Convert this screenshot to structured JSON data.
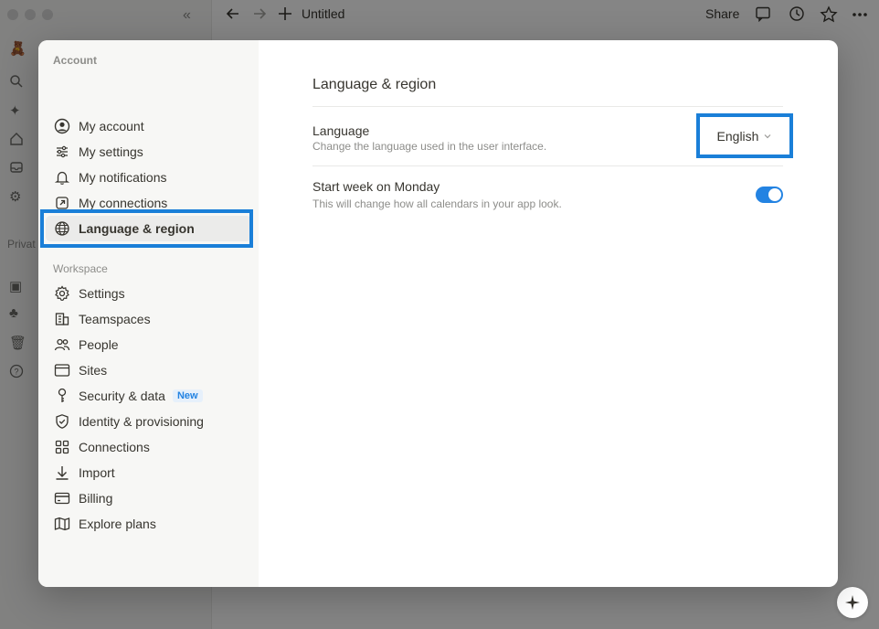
{
  "topbar": {
    "page_title": "Untitled",
    "share_label": "Share"
  },
  "background_sidebar": {
    "section_label": "Privat"
  },
  "modal": {
    "account_label": "Account",
    "account_items": [
      {
        "label": "My account",
        "icon": "user-circle-icon"
      },
      {
        "label": "My settings",
        "icon": "sliders-icon"
      },
      {
        "label": "My notifications",
        "icon": "bell-icon"
      },
      {
        "label": "My connections",
        "icon": "external-link-icon"
      },
      {
        "label": "Language & region",
        "icon": "globe-icon",
        "active": true
      }
    ],
    "workspace_label": "Workspace",
    "workspace_items": [
      {
        "label": "Settings",
        "icon": "gear-icon"
      },
      {
        "label": "Teamspaces",
        "icon": "building-icon"
      },
      {
        "label": "People",
        "icon": "people-icon"
      },
      {
        "label": "Sites",
        "icon": "browser-icon"
      },
      {
        "label": "Security & data",
        "icon": "key-icon",
        "badge": "New"
      },
      {
        "label": "Identity & provisioning",
        "icon": "shield-check-icon"
      },
      {
        "label": "Connections",
        "icon": "grid-icon"
      },
      {
        "label": "Import",
        "icon": "download-icon"
      },
      {
        "label": "Billing",
        "icon": "credit-card-icon"
      },
      {
        "label": "Explore plans",
        "icon": "map-icon"
      }
    ],
    "content": {
      "title": "Language & region",
      "language": {
        "title": "Language",
        "description": "Change the language used in the user interface.",
        "value": "English"
      },
      "start_week": {
        "title": "Start week on Monday",
        "description": "This will change how all calendars in your app look.",
        "enabled": true
      }
    }
  },
  "colors": {
    "accent": "#2383e2",
    "highlight": "#1a7fd8"
  }
}
